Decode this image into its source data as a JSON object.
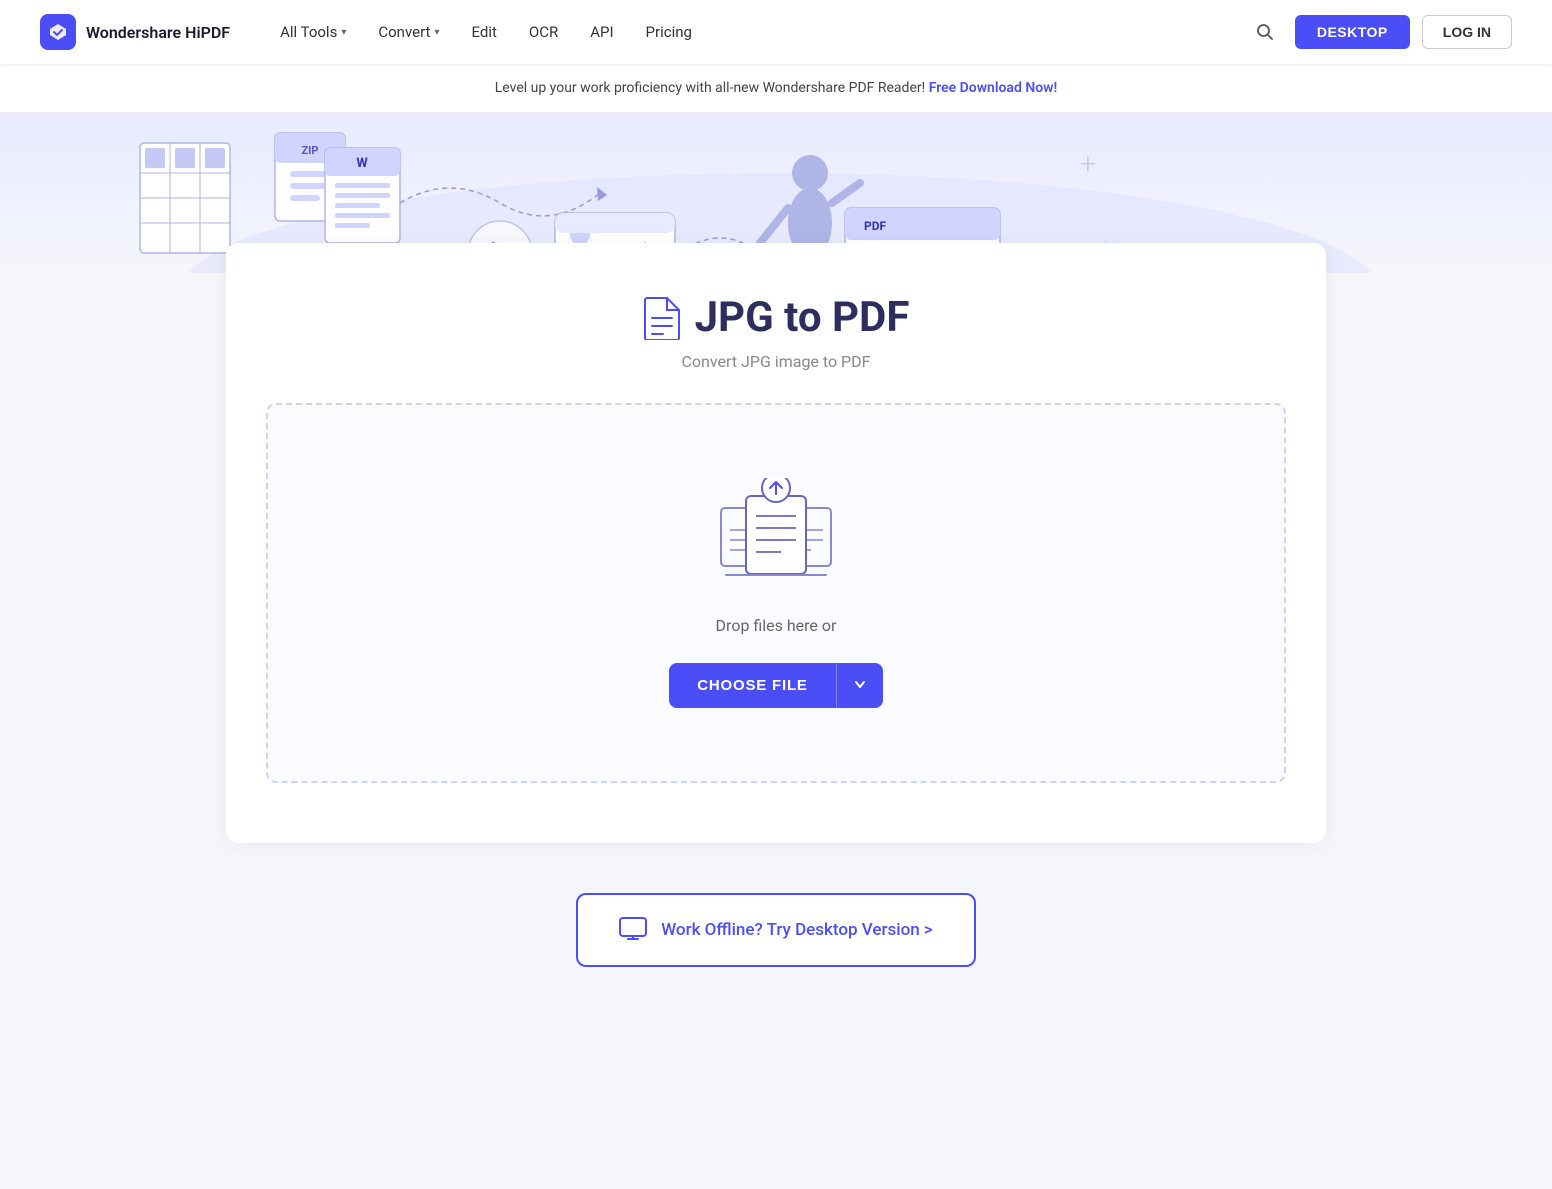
{
  "brand": {
    "name": "Wondershare HiPDF"
  },
  "nav": {
    "items": [
      {
        "label": "All Tools",
        "hasDropdown": true
      },
      {
        "label": "Convert",
        "hasDropdown": true
      },
      {
        "label": "Edit",
        "hasDropdown": false
      },
      {
        "label": "OCR",
        "hasDropdown": false
      },
      {
        "label": "API",
        "hasDropdown": false
      },
      {
        "label": "Pricing",
        "hasDropdown": false
      }
    ],
    "desktop_btn": "DESKTOP",
    "login_btn": "LOG IN"
  },
  "banner": {
    "text": "Level up your work proficiency with all-new Wondershare PDF Reader!",
    "link_text": "Free Download Now!"
  },
  "tool": {
    "title": "JPG to PDF",
    "subtitle": "Convert JPG image to PDF",
    "drop_text": "Drop files here or",
    "choose_btn": "CHOOSE FILE"
  },
  "desktop_cta": {
    "text": "Work Offline? Try Desktop Version >"
  }
}
